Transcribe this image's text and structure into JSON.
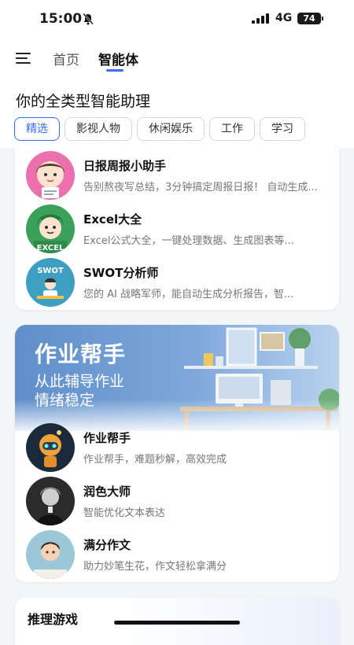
{
  "status": {
    "time": "15:00",
    "network": "4G",
    "battery": "74"
  },
  "header": {
    "tabs": [
      "首页",
      "智能体"
    ]
  },
  "subtitle": "你的全类型智能助理",
  "chips": [
    "精选",
    "影视人物",
    "休闲娱乐",
    "工作",
    "学习"
  ],
  "featured": [
    {
      "title": "日报周报小助手",
      "desc": "告别熬夜写总结，3分钟搞定周报日报！ 自动生成..."
    },
    {
      "title": "Excel大全",
      "desc": "Excel公式大全，一键处理数据、生成图表等..."
    },
    {
      "title": "SWOT分析师",
      "desc": "您的 AI 战略军师，能自动生成分析报告，智..."
    }
  ],
  "banner": {
    "title": "作业帮手",
    "line1": "从此辅导作业",
    "line2": "情绪稳定"
  },
  "homework": [
    {
      "title": "作业帮手",
      "desc": "作业帮手，难题秒解，高效完成"
    },
    {
      "title": "润色大师",
      "desc": "智能优化文本表达"
    },
    {
      "title": "满分作文",
      "desc": "助力妙笔生花，作文轻松拿满分"
    }
  ],
  "next_section": {
    "title": "推理游戏"
  },
  "avatar_labels": {
    "swot": "SWOT",
    "excel": "EXCEL"
  },
  "colors": {
    "accent": "#3b6cf5",
    "banner": "#6f9bd3"
  }
}
